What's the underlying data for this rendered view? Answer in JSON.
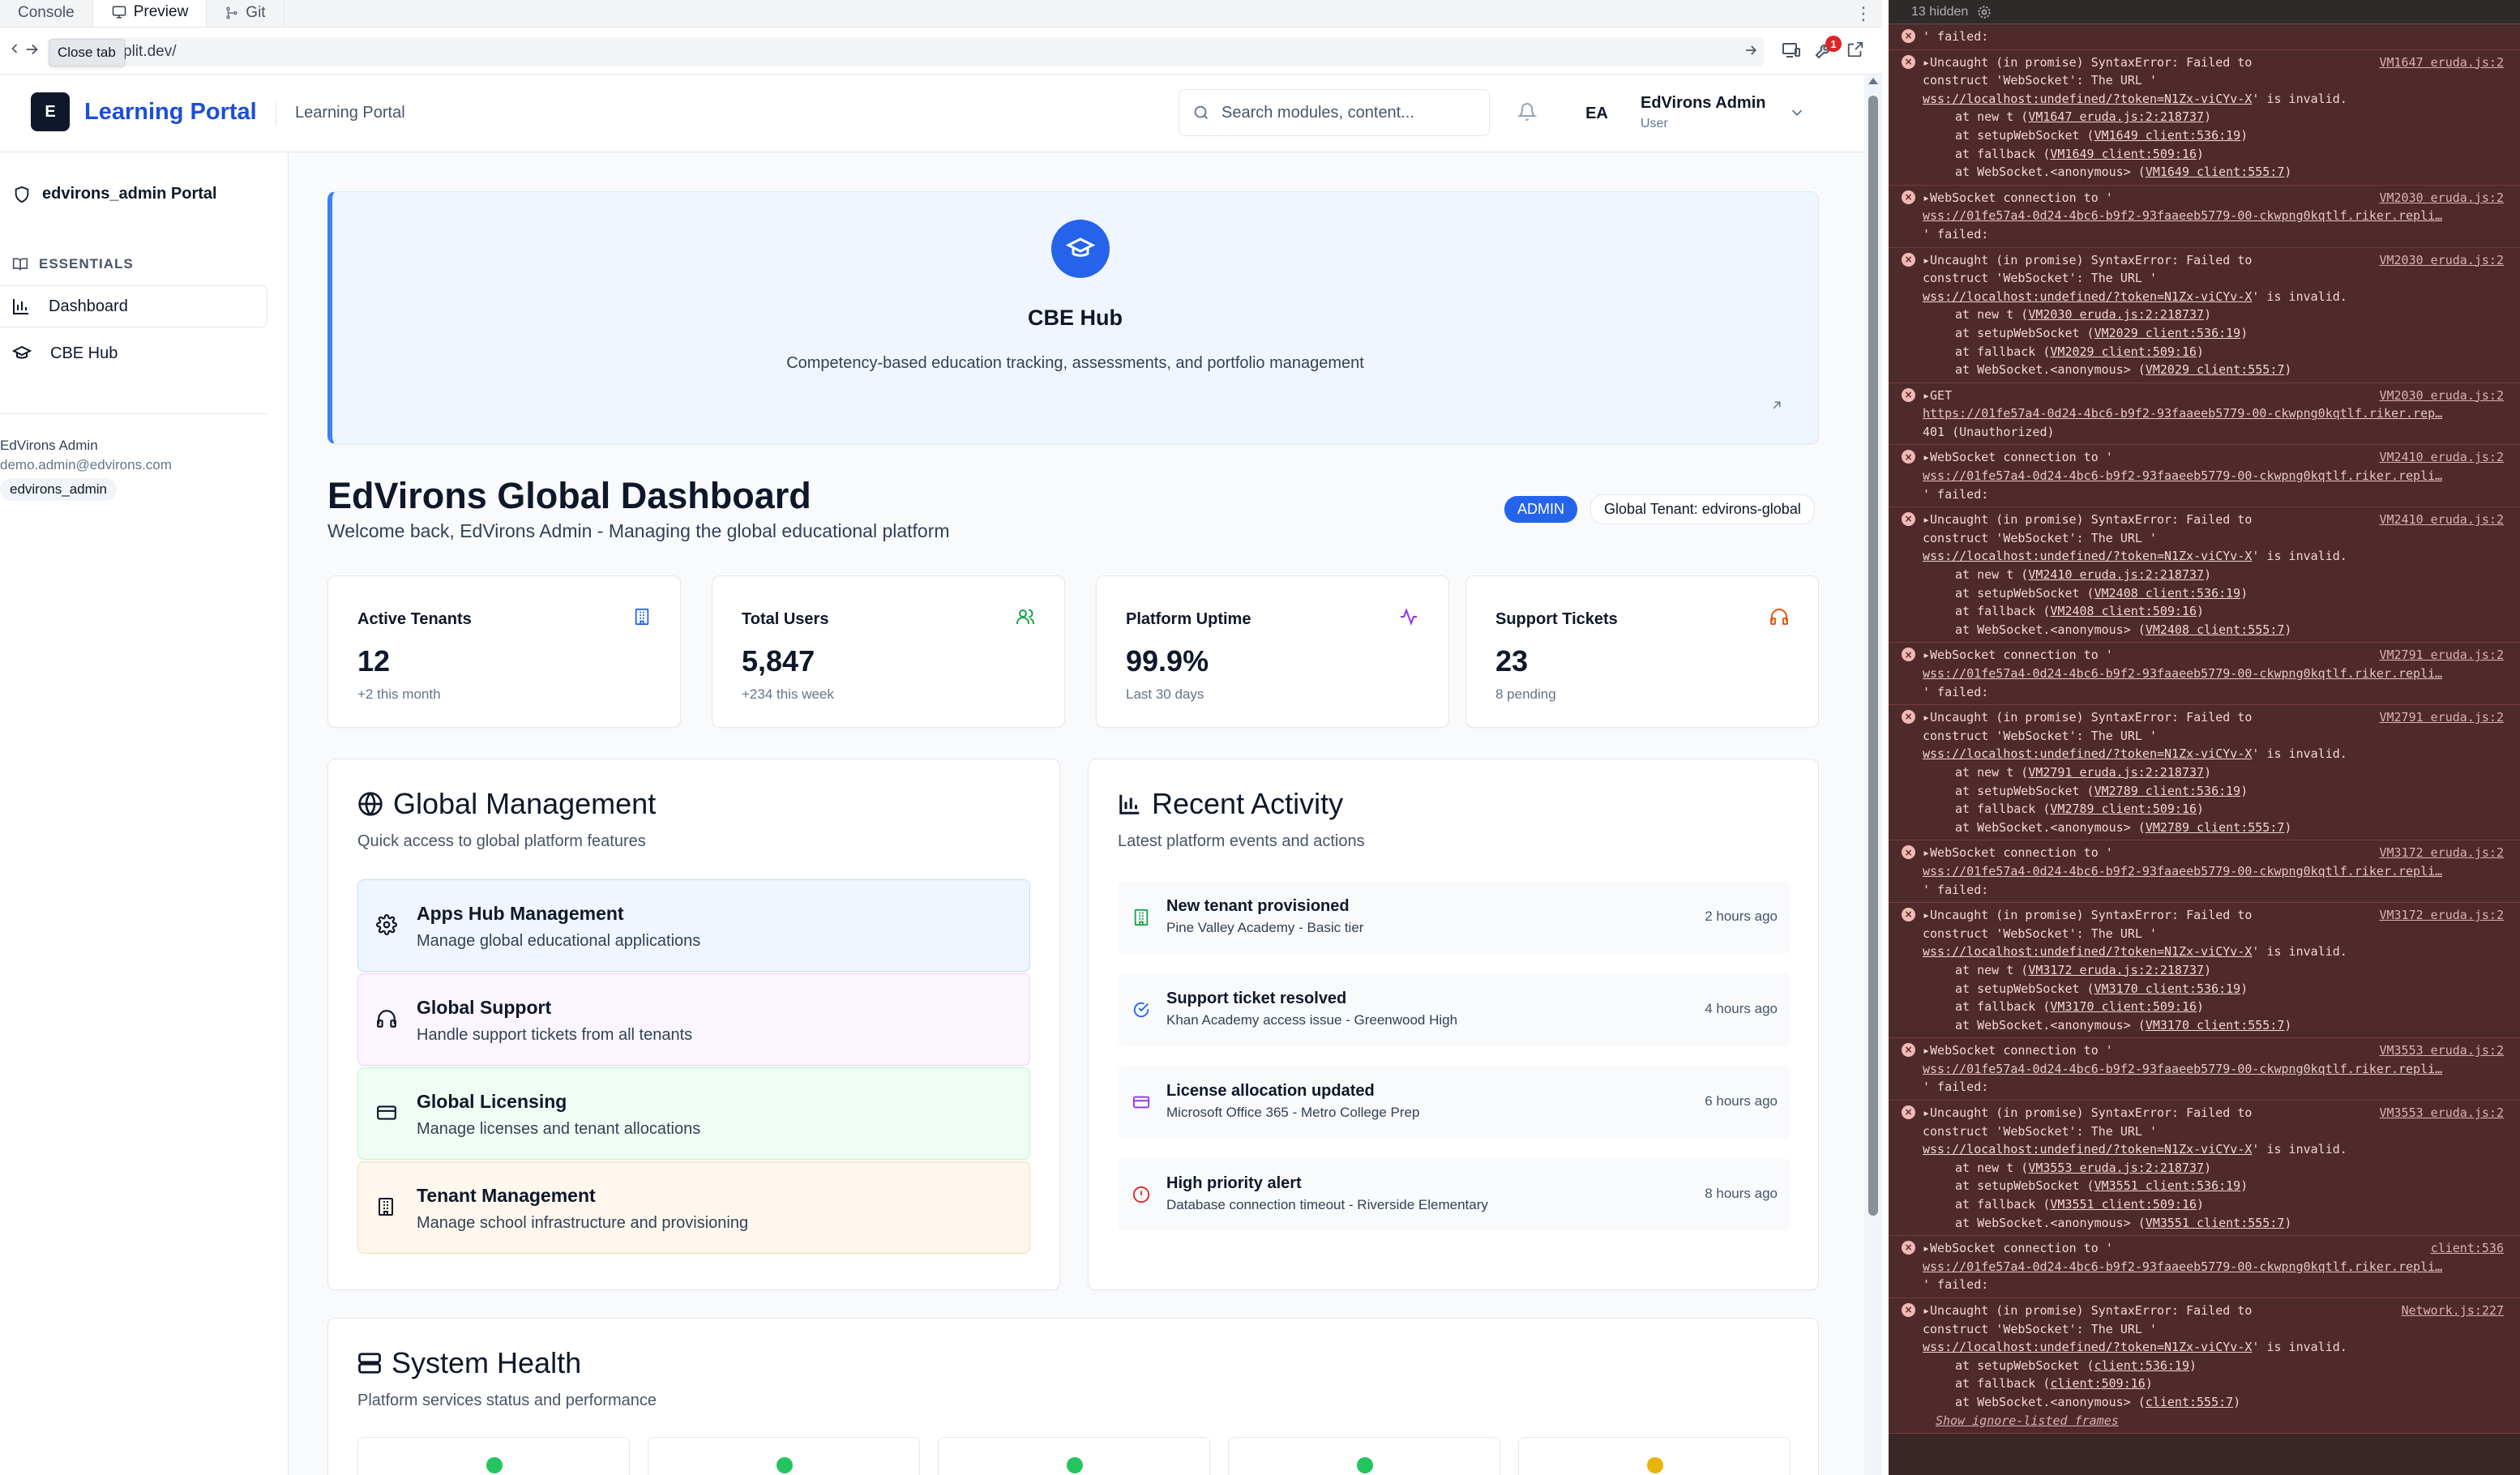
{
  "editor": {
    "tabs": [
      "Console",
      "Preview",
      "Git"
    ],
    "url": "plit.dev/",
    "tooltip": "Close tab",
    "notification_count": "1"
  },
  "header": {
    "logo_letter": "E",
    "brand": "Learning Portal",
    "subtitle": "Learning Portal",
    "search_placeholder": "Search modules, content...",
    "avatar_initials": "EA",
    "user_name": "EdVirons Admin",
    "user_role": "User"
  },
  "sidebar": {
    "portal": "edvirons_admin Portal",
    "section": "ESSENTIALS",
    "items": [
      "Dashboard",
      "CBE Hub"
    ],
    "user_name": "EdVirons Admin",
    "user_email": "demo.admin@edvirons.com",
    "user_tag": "edvirons_admin"
  },
  "cbe": {
    "title": "CBE Hub",
    "description": "Competency-based education tracking, assessments, and portfolio management"
  },
  "dashboard": {
    "title": "EdVirons Global Dashboard",
    "welcome": "Welcome back, EdVirons Admin - Managing the global educational platform",
    "role_badge": "ADMIN",
    "tenant_badge": "Global Tenant: edvirons-global"
  },
  "stats": [
    {
      "label": "Active Tenants",
      "value": "12",
      "sub": "+2 this month",
      "icon": "building-icon",
      "color": "#2563eb"
    },
    {
      "label": "Total Users",
      "value": "5,847",
      "sub": "+234 this week",
      "icon": "users-icon",
      "color": "#16a34a"
    },
    {
      "label": "Platform Uptime",
      "value": "99.9%",
      "sub": "Last 30 days",
      "icon": "activity-icon",
      "color": "#9333ea"
    },
    {
      "label": "Support Tickets",
      "value": "23",
      "sub": "8 pending",
      "icon": "headphones-icon",
      "color": "#ea580c"
    }
  ],
  "global_management": {
    "title": "Global Management",
    "subtitle": "Quick access to global platform features",
    "items": [
      {
        "title": "Apps Hub Management",
        "desc": "Manage global educational applications",
        "icon": "gear-icon",
        "bg": "#eff6ff",
        "border": "#bfdbfe"
      },
      {
        "title": "Global Support",
        "desc": "Handle support tickets from all tenants",
        "icon": "headphones-icon",
        "bg": "#faf5ff",
        "border": "#e9d5ff"
      },
      {
        "title": "Global Licensing",
        "desc": "Manage licenses and tenant allocations",
        "icon": "credit-card-icon",
        "bg": "#f0fdf4",
        "border": "#bbf7d0"
      },
      {
        "title": "Tenant Management",
        "desc": "Manage school infrastructure and provisioning",
        "icon": "building-icon",
        "bg": "#fff7ed",
        "border": "#fed7aa"
      }
    ]
  },
  "recent_activity": {
    "title": "Recent Activity",
    "subtitle": "Latest platform events and actions",
    "items": [
      {
        "title": "New tenant provisioned",
        "desc": "Pine Valley Academy - Basic tier",
        "time": "2 hours ago",
        "icon": "building-icon",
        "color": "#16a34a"
      },
      {
        "title": "Support ticket resolved",
        "desc": "Khan Academy access issue - Greenwood High",
        "time": "4 hours ago",
        "icon": "check-circle-icon",
        "color": "#2563eb"
      },
      {
        "title": "License allocation updated",
        "desc": "Microsoft Office 365 - Metro College Prep",
        "time": "6 hours ago",
        "icon": "credit-card-icon",
        "color": "#9333ea"
      },
      {
        "title": "High priority alert",
        "desc": "Database connection timeout - Riverside Elementary",
        "time": "8 hours ago",
        "icon": "alert-circle-icon",
        "color": "#dc2626"
      }
    ]
  },
  "system_health": {
    "title": "System Health",
    "subtitle": "Platform services status and performance",
    "status_colors": [
      "#22c55e",
      "#22c55e",
      "#22c55e",
      "#22c55e",
      "#eab308"
    ]
  },
  "console": {
    "hidden": "13 hidden",
    "footer": "Show ignore-listed frames",
    "logs": [
      {
        "lines": [
          "' failed:"
        ]
      },
      {
        "src": "VM1647 eruda.js:2",
        "lines": [
          "▸Uncaught (in promise) SyntaxError: Failed to",
          "construct 'WebSocket': The URL '",
          "~wss://localhost:undefined/?token=N1Zx-viCYv-X~' is invalid.",
          "!at new t (~VM1647 eruda.js:2:218737~)",
          "!at setupWebSocket (~VM1649 client:536:19~)",
          "!at fallback (~VM1649 client:509:16~)",
          "!at WebSocket.<anonymous> (~VM1649 client:555:7~)"
        ]
      },
      {
        "src": "VM2030 eruda.js:2",
        "lines": [
          "▸WebSocket connection to '",
          "~wss://01fe57a4-0d24-4bc6-b9f2-93faaeeb5779-00-ckwpng0kqtlf.riker.repli…~",
          "' failed:"
        ]
      },
      {
        "src": "VM2030 eruda.js:2",
        "lines": [
          "▸Uncaught (in promise) SyntaxError: Failed to",
          "construct 'WebSocket': The URL '",
          "~wss://localhost:undefined/?token=N1Zx-viCYv-X~' is invalid.",
          "!at new t (~VM2030 eruda.js:2:218737~)",
          "!at setupWebSocket (~VM2029 client:536:19~)",
          "!at fallback (~VM2029 client:509:16~)",
          "!at WebSocket.<anonymous> (~VM2029 client:555:7~)"
        ]
      },
      {
        "src": "VM2030 eruda.js:2",
        "lines": [
          "▸GET",
          "~https://01fe57a4-0d24-4bc6-b9f2-93faaeeb5779-00-ckwpng0kqtlf.riker.rep…~",
          "401 (Unauthorized)"
        ]
      },
      {
        "src": "VM2410 eruda.js:2",
        "lines": [
          "▸WebSocket connection to '",
          "~wss://01fe57a4-0d24-4bc6-b9f2-93faaeeb5779-00-ckwpng0kqtlf.riker.repli…~",
          "' failed:"
        ]
      },
      {
        "src": "VM2410 eruda.js:2",
        "lines": [
          "▸Uncaught (in promise) SyntaxError: Failed to",
          "construct 'WebSocket': The URL '",
          "~wss://localhost:undefined/?token=N1Zx-viCYv-X~' is invalid.",
          "!at new t (~VM2410 eruda.js:2:218737~)",
          "!at setupWebSocket (~VM2408 client:536:19~)",
          "!at fallback (~VM2408 client:509:16~)",
          "!at WebSocket.<anonymous> (~VM2408 client:555:7~)"
        ]
      },
      {
        "src": "VM2791 eruda.js:2",
        "lines": [
          "▸WebSocket connection to '",
          "~wss://01fe57a4-0d24-4bc6-b9f2-93faaeeb5779-00-ckwpng0kqtlf.riker.repli…~",
          "' failed:"
        ]
      },
      {
        "src": "VM2791 eruda.js:2",
        "lines": [
          "▸Uncaught (in promise) SyntaxError: Failed to",
          "construct 'WebSocket': The URL '",
          "~wss://localhost:undefined/?token=N1Zx-viCYv-X~' is invalid.",
          "!at new t (~VM2791 eruda.js:2:218737~)",
          "!at setupWebSocket (~VM2789 client:536:19~)",
          "!at fallback (~VM2789 client:509:16~)",
          "!at WebSocket.<anonymous> (~VM2789 client:555:7~)"
        ]
      },
      {
        "src": "VM3172 eruda.js:2",
        "lines": [
          "▸WebSocket connection to '",
          "~wss://01fe57a4-0d24-4bc6-b9f2-93faaeeb5779-00-ckwpng0kqtlf.riker.repli…~",
          "' failed:"
        ]
      },
      {
        "src": "VM3172 eruda.js:2",
        "lines": [
          "▸Uncaught (in promise) SyntaxError: Failed to",
          "construct 'WebSocket': The URL '",
          "~wss://localhost:undefined/?token=N1Zx-viCYv-X~' is invalid.",
          "!at new t (~VM3172 eruda.js:2:218737~)",
          "!at setupWebSocket (~VM3170 client:536:19~)",
          "!at fallback (~VM3170 client:509:16~)",
          "!at WebSocket.<anonymous> (~VM3170 client:555:7~)"
        ]
      },
      {
        "src": "VM3553 eruda.js:2",
        "lines": [
          "▸WebSocket connection to '",
          "~wss://01fe57a4-0d24-4bc6-b9f2-93faaeeb5779-00-ckwpng0kqtlf.riker.repli…~",
          "' failed:"
        ]
      },
      {
        "src": "VM3553 eruda.js:2",
        "lines": [
          "▸Uncaught (in promise) SyntaxError: Failed to",
          "construct 'WebSocket': The URL '",
          "~wss://localhost:undefined/?token=N1Zx-viCYv-X~' is invalid.",
          "!at new t (~VM3553 eruda.js:2:218737~)",
          "!at setupWebSocket (~VM3551 client:536:19~)",
          "!at fallback (~VM3551 client:509:16~)",
          "!at WebSocket.<anonymous> (~VM3551 client:555:7~)"
        ]
      },
      {
        "src": "client:536",
        "lines": [
          "▸WebSocket connection to '",
          "~wss://01fe57a4-0d24-4bc6-b9f2-93faaeeb5779-00-ckwpng0kqtlf.riker.repli…~",
          "' failed:"
        ]
      },
      {
        "src": "Network.js:227",
        "lines": [
          "▸Uncaught (in promise) SyntaxError: Failed to",
          "construct 'WebSocket': The URL '",
          "~wss://localhost:undefined/?token=N1Zx-viCYv-X~' is invalid.",
          "!at setupWebSocket (~client:536:19~)",
          "!at fallback (~client:509:16~)",
          "!at WebSocket.<anonymous> (~client:555:7~)"
        ],
        "footer": true
      }
    ]
  }
}
